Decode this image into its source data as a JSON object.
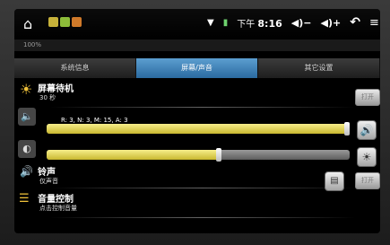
{
  "statusbar": {
    "time_prefix": "下午",
    "time": "8:16",
    "vol_down": "◀)−",
    "vol_up": "◀)+",
    "back_icon": "arrow-back-icon",
    "menu_icon": "menu-icon"
  },
  "title_strip": "100%",
  "tabs": [
    {
      "label": "系统信息",
      "active": false
    },
    {
      "label": "屏幕/声音",
      "active": true
    },
    {
      "label": "其它设置",
      "active": false
    }
  ],
  "screen_timeout": {
    "title": "屏幕待机",
    "value": "30 秒",
    "button": "打开"
  },
  "volume_slider": {
    "info": "R: 3, N: 3, M: 15, A: 3",
    "level": 0.99
  },
  "brightness_slider": {
    "level": 0.56
  },
  "ringtone": {
    "title": "铃声",
    "subtitle": "仅声音",
    "button": "打开"
  },
  "volume_control": {
    "title": "音量控制",
    "subtitle": "点击控制音量"
  },
  "colors": {
    "active_tab": "#3f86c0",
    "slider_fill": "#e8dc5a",
    "accent_yellow": "#f0c23a"
  }
}
